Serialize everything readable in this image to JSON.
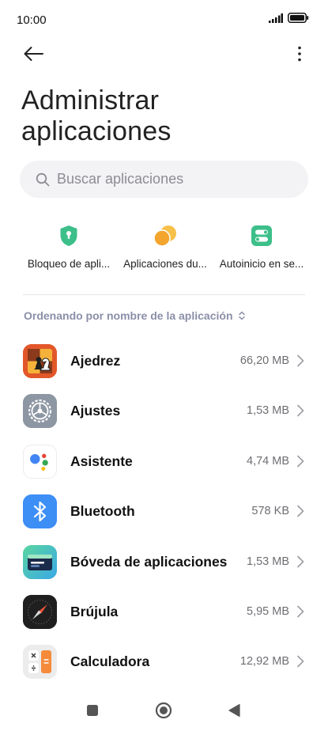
{
  "status": {
    "time": "10:00",
    "icons": [
      "signal-icon",
      "battery-icon"
    ]
  },
  "toolbar": {
    "back_icon": "arrow-left-icon",
    "more_icon": "more-vertical-icon"
  },
  "page": {
    "title_line1": "Administrar",
    "title_line2": "aplicaciones"
  },
  "search": {
    "placeholder": "Buscar aplicaciones",
    "icon": "search-icon"
  },
  "shortcuts": [
    {
      "label": "Bloqueo de apli...",
      "icon": "shield-lock-icon",
      "color": "#3dbf8a"
    },
    {
      "label": "Aplicaciones du...",
      "icon": "dual-apps-icon",
      "color": "#f6b73c"
    },
    {
      "label": "Autoinicio en se...",
      "icon": "toggle-autostart-icon",
      "color": "#3dbf8a"
    }
  ],
  "sort": {
    "label": "Ordenando por nombre de la aplicación",
    "icon": "sort-updown-icon"
  },
  "apps": [
    {
      "name": "Ajedrez",
      "size": "66,20 MB",
      "icon": "chess-icon"
    },
    {
      "name": "Ajustes",
      "size": "1,53 MB",
      "icon": "settings-gear-icon"
    },
    {
      "name": "Asistente",
      "size": "4,74 MB",
      "icon": "assistant-dots-icon"
    },
    {
      "name": "Bluetooth",
      "size": "578 KB",
      "icon": "bluetooth-icon"
    },
    {
      "name": "Bóveda de aplicaciones",
      "size": "1,53 MB",
      "icon": "app-vault-icon"
    },
    {
      "name": "Brújula",
      "size": "5,95 MB",
      "icon": "compass-icon"
    },
    {
      "name": "Calculadora",
      "size": "12,92 MB",
      "icon": "calculator-icon"
    }
  ],
  "navbar": {
    "icons": [
      "square-recents-icon",
      "circle-home-icon",
      "triangle-back-icon"
    ]
  }
}
